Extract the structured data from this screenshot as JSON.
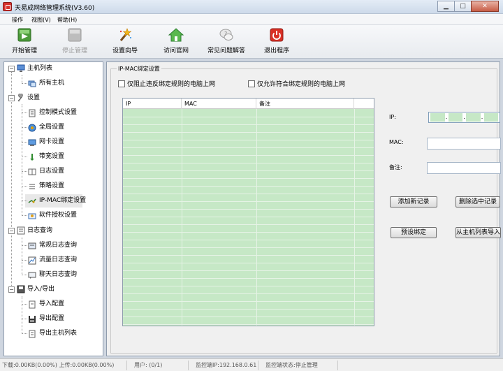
{
  "window": {
    "title": "天易成网络管理系统(V3.60)",
    "colors": {
      "title_bg": "#cddaea",
      "grid_fill": "#c6e8c6",
      "close_button": "#c75d46"
    }
  },
  "menu": [
    "操作",
    "视图(V)",
    "帮助(H)"
  ],
  "toolbar": [
    {
      "label": "开始管理",
      "icon": "start-management-icon",
      "enabled": true
    },
    {
      "label": "停止管理",
      "icon": "stop-management-icon",
      "enabled": false
    },
    {
      "label": "设置向导",
      "icon": "wizard-wand-icon",
      "enabled": true
    },
    {
      "label": "访问官网",
      "icon": "home-icon",
      "enabled": true
    },
    {
      "label": "常见问题解答",
      "icon": "faq-icon",
      "enabled": true
    },
    {
      "label": "退出程序",
      "icon": "power-icon",
      "enabled": true
    }
  ],
  "tree": [
    {
      "label": "主机列表",
      "icon": "computer-icon",
      "expanded": true,
      "children": [
        {
          "label": "所有主机",
          "icon": "hosts-icon"
        }
      ]
    },
    {
      "label": "设置",
      "icon": "wrench-icon",
      "expanded": true,
      "children": [
        {
          "label": "控制模式设置",
          "icon": "control-mode-icon"
        },
        {
          "label": "全局设置",
          "icon": "globe-gear-icon"
        },
        {
          "label": "网卡设置",
          "icon": "network-card-icon"
        },
        {
          "label": "带宽设置",
          "icon": "bandwidth-arrow-icon"
        },
        {
          "label": "日志设置",
          "icon": "log-book-icon"
        },
        {
          "label": "策略设置",
          "icon": "policy-list-icon"
        },
        {
          "label": "IP-MAC绑定设置",
          "icon": "ip-mac-bind-icon",
          "selected": true
        },
        {
          "label": "软件授权设置",
          "icon": "license-icon"
        }
      ]
    },
    {
      "label": "日志查询",
      "icon": "log-query-icon",
      "expanded": true,
      "children": [
        {
          "label": "常规日志查询",
          "icon": "regular-log-icon"
        },
        {
          "label": "流量日志查询",
          "icon": "traffic-chart-icon"
        },
        {
          "label": "聊天日志查询",
          "icon": "chat-log-icon"
        }
      ]
    },
    {
      "label": "导入/导出",
      "icon": "import-export-icon",
      "expanded": true,
      "children": [
        {
          "label": "导入配置",
          "icon": "import-icon"
        },
        {
          "label": "导出配置",
          "icon": "save-disk-icon"
        },
        {
          "label": "导出主机列表",
          "icon": "export-list-icon"
        }
      ]
    }
  ],
  "binding": {
    "group_title": "IP-MAC绑定设置",
    "check_block": "仅阻止违反绑定规则的电脑上网",
    "check_allow": "仅允许符合绑定规则的电脑上网",
    "columns": [
      "IP",
      "MAC",
      "备注"
    ],
    "ip_label": "IP:",
    "ip_dots": [
      ".",
      ".",
      "."
    ],
    "mac_label": "MAC:",
    "note_label": "备注:",
    "mac_value": "",
    "note_value": "",
    "btn_add": "添加新记录",
    "btn_delete": "删除选中记录",
    "btn_preset": "预设绑定",
    "btn_import": "从主机列表导入"
  },
  "status": {
    "transfer": "下载:0.00KB(0.00%) 上传:0.00KB(0.00%)",
    "users": "用户: (0/1)",
    "monitor_ip": "监控端IP:192.168.0.61",
    "monitor_state": "监控端状态:停止管理"
  }
}
